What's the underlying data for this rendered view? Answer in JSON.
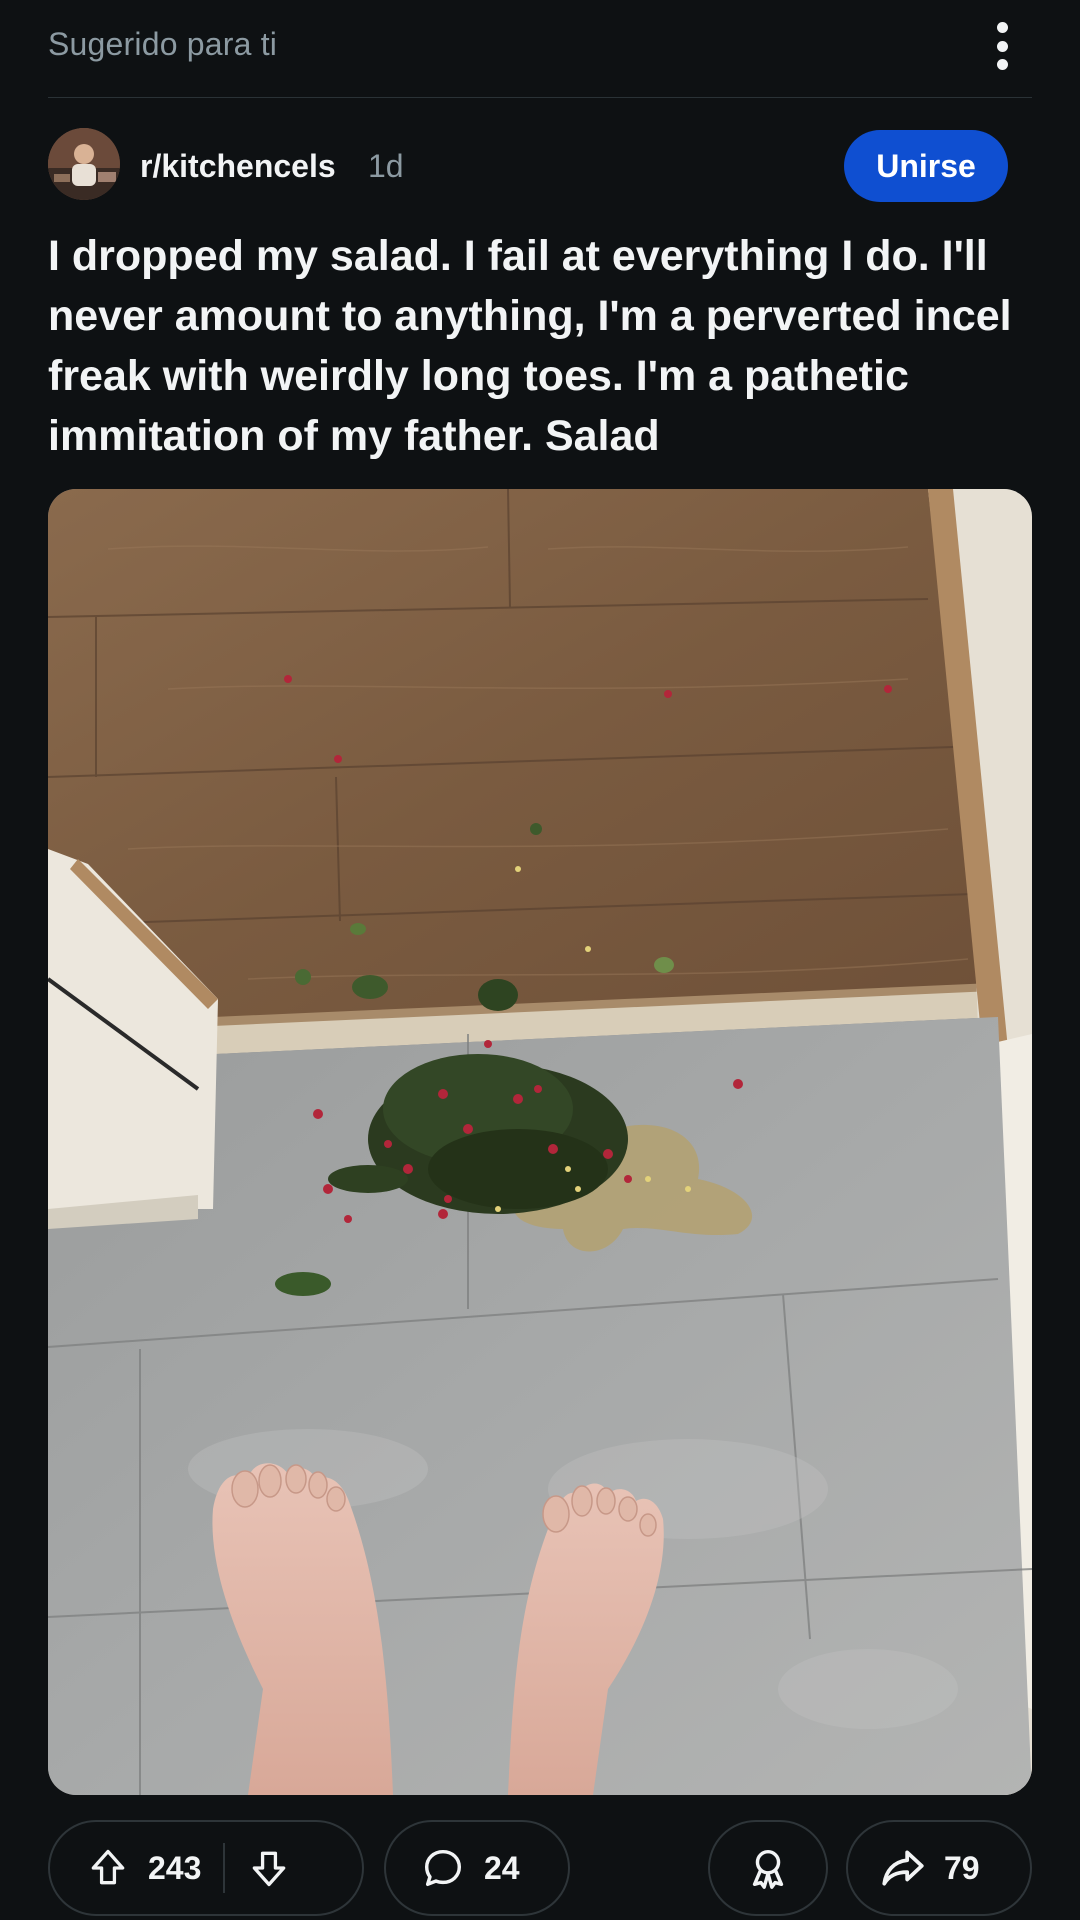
{
  "feed": {
    "suggested_label": "Sugerido para ti"
  },
  "post": {
    "subreddit": "r/kitchencels",
    "age": "1d",
    "join_label": "Unirse",
    "title": "I dropped my salad. I fail at everything I do. I'll never amount to anything, I'm a perverted incel freak with weirdly long toes. I'm a pathetic immitation of my father. Salad",
    "upvotes": "243",
    "comments": "24",
    "shares": "79"
  },
  "icons": {
    "menu": "more-vertical-icon",
    "upvote": "arrow-up-icon",
    "downvote": "arrow-down-icon",
    "comment": "speech-bubble-icon",
    "award": "award-ribbon-icon",
    "share": "share-arrow-icon"
  },
  "colors": {
    "background": "#0e1113",
    "join_button": "#0f4fd1",
    "muted_text": "#8c9aa2",
    "text": "#f2f4f5"
  }
}
